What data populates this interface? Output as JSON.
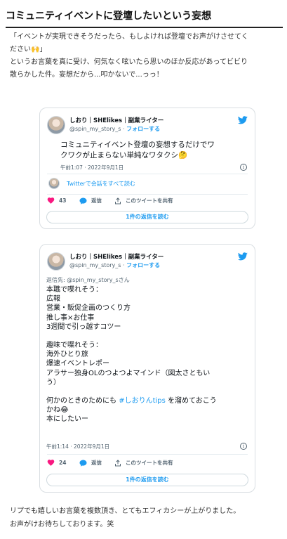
{
  "article": {
    "heading": "コミュニティイベントに登壇したいという妄想",
    "intro_lines": [
      "「イベントが実現できそうだったら、もしよければ登壇でお声がけさせてく",
      "ださい🙌」",
      "というお言葉を真に受け、何気なく呟いたら思いのほか反応があってビビり",
      "散らかした件。妄想だから...叩かないで...っっ！"
    ],
    "outro_lines": [
      "リプでも嬉しいお言葉を複数頂き、とてもエフィカシーが上がりました。",
      "お声がけお待ちしております。笑"
    ]
  },
  "tweet1": {
    "name": "しおり｜SHElikes｜副業ライター",
    "handle": "@spin_my_story_s",
    "separator": " · ",
    "follow": "フォローする",
    "body_lines": [
      "コミュニティイベント登壇の妄想するだけでワ",
      "クワクが止まらない単純なワタクシ🤔"
    ],
    "time": "午前1:07 · 2022年9月1日",
    "thread_link": "Twitterで会話をすべて読む",
    "likes": "43",
    "reply_label": "返信",
    "share_label": "このツイートを共有",
    "read_replies": "1件の返信を読む"
  },
  "tweet2": {
    "name": "しおり｜SHElikes｜副業ライター",
    "handle": "@spin_my_story_s",
    "separator": " · ",
    "follow": "フォローする",
    "reply_to": "返信先: @spin_my_story_sさん",
    "body_blocks": [
      [
        "本職で喋れそう：",
        "広報",
        "営業・販促企画のつくり方",
        "推し事×お仕事",
        "3週間で引っ越すコツー"
      ],
      [
        "趣味で喋れそう：",
        "海外ひとり旅",
        "爆速イベントレポー",
        "アラサー独身OLのつよつよマインド（図太さともい",
        "う）"
      ]
    ],
    "closing_prefix": "何かのときのためにも ",
    "hashtag": "#しおりんtips",
    "closing_suffix": " を溜めておこう",
    "closing_line2": "かね😂",
    "closing_line3": "本にしたいー",
    "time": "午前1:14 · 2022年9月1日",
    "likes": "24",
    "reply_label": "返信",
    "share_label": "このツイートを共有",
    "read_replies": "1件の返信を読む"
  },
  "colors": {
    "twitter_blue": "#1d9bf0",
    "heart_red": "#f91880",
    "muted": "#536471"
  },
  "icons": [
    "twitter-bird-icon",
    "heart-icon",
    "reply-bubble-icon",
    "share-icon",
    "info-icon"
  ]
}
